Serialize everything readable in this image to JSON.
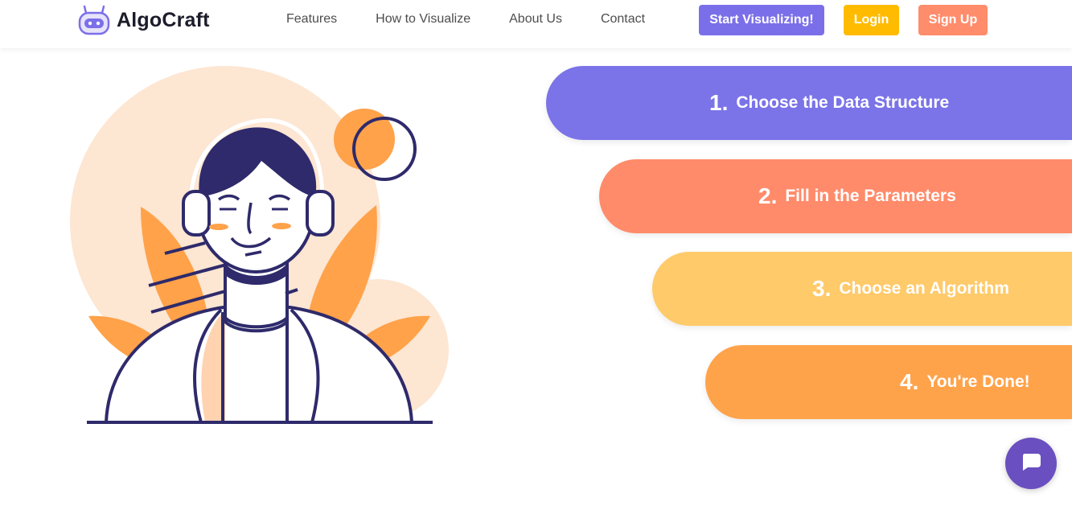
{
  "navbar": {
    "brand": {
      "name": "AlgoCraft",
      "logo_icon": "robot-icon",
      "accent": "#7b6fe9"
    },
    "links": [
      {
        "label": "Features"
      },
      {
        "label": "How to Visualize"
      },
      {
        "label": "About Us"
      },
      {
        "label": "Contact"
      }
    ],
    "buttons": {
      "start": {
        "label": "Start Visualizing!",
        "color": "#7b6fe9"
      },
      "login": {
        "label": "Login",
        "color": "#ffbb00"
      },
      "signup": {
        "label": "Sign Up",
        "color": "#ff8c6b"
      }
    }
  },
  "hero": {
    "illustration": "person-with-headphones-illustration",
    "colors": {
      "navy": "#2e2a6b",
      "peach": "#fde6d2",
      "orange": "#ffa24a",
      "skin": "#ffffff"
    }
  },
  "steps": [
    {
      "number": "1.",
      "label": "Choose the Data Structure",
      "color": "#7b73e8"
    },
    {
      "number": "2.",
      "label": "Fill in the Parameters",
      "color": "#ff8b6a"
    },
    {
      "number": "3.",
      "label": "Choose an Algorithm",
      "color": "#ffca6a"
    },
    {
      "number": "4.",
      "label": "You're Done!",
      "color": "#ffa34b"
    }
  ],
  "chat": {
    "icon": "chat-bubble-icon",
    "color": "#6a4fc0"
  }
}
